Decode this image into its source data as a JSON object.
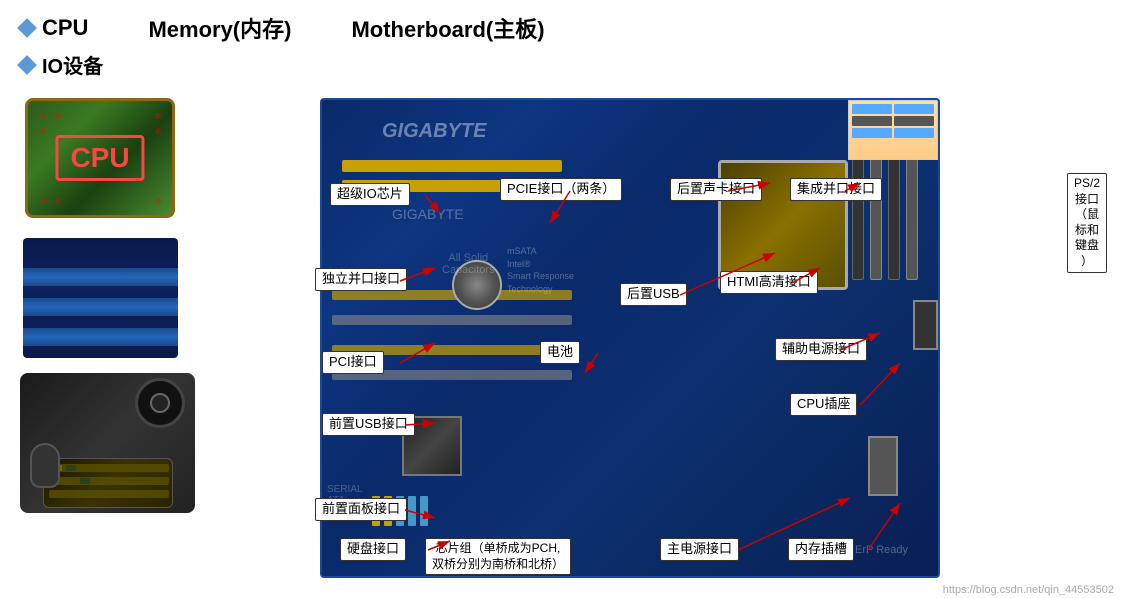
{
  "header": {
    "items": [
      {
        "label": "CPU",
        "diamond": true
      },
      {
        "label": "Memory(内存)",
        "diamond": false
      },
      {
        "label": "Motherboard(主板)",
        "diamond": false
      }
    ],
    "sub_item": {
      "label": "IO设备",
      "diamond": true
    }
  },
  "labels": {
    "super_io": "超级IO芯片",
    "pcie": "PCIE接口（两条）",
    "rear_sound": "后置声卡接口",
    "parallel_integrated": "集成并口接口",
    "ps2": "PS/2\n接口\n（鼠\n标和\n键盘\n）",
    "standalone_parallel": "独立并口接口",
    "htmi": "HTMI高清接口",
    "rear_usb": "后置USB",
    "pci": "PCI接口",
    "battery": "电池",
    "aux_power": "辅助电源接口",
    "cpu_slot": "CPU插座",
    "front_usb": "前置USB接口",
    "front_panel": "前置面板接口",
    "hdd": "硬盘接口",
    "chipset": "芯片组（单桥成为PCH,\n双桥分别为南桥和北桥）",
    "main_power": "主电源接口",
    "ram_slot": "内存插槽",
    "watermark": "https://blog.csdn.net/qin_44553502"
  }
}
